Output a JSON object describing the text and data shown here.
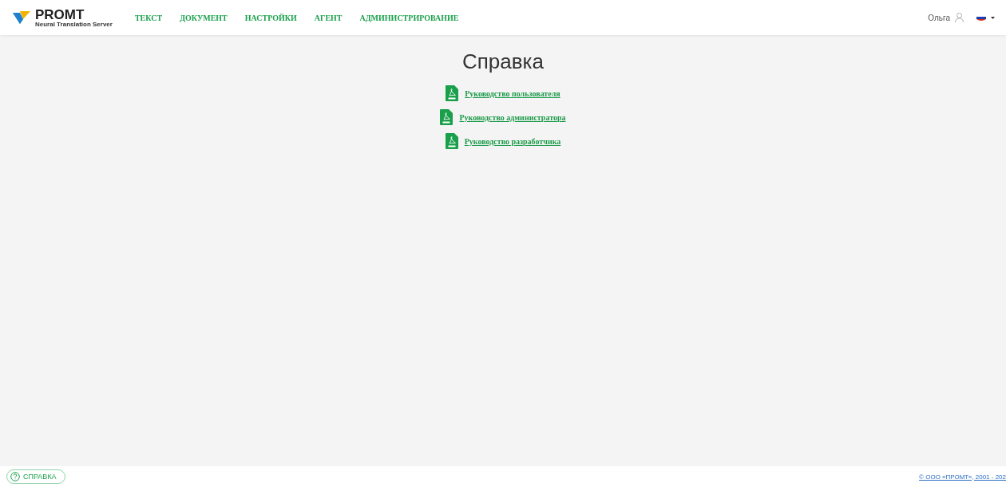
{
  "logo": {
    "name": "PROMT",
    "subtitle": "Neural Translation Server"
  },
  "nav": [
    "ТЕКСТ",
    "ДОКУМЕНТ",
    "НАСТРОЙКИ",
    "АГЕНТ",
    "АДМИНИСТРИРОВАНИЕ"
  ],
  "user": {
    "name": "Ольга"
  },
  "page": {
    "title": "Справка",
    "documents": [
      "Руководство пользователя",
      "Руководство администратора",
      "Руководство разработчика"
    ]
  },
  "footer": {
    "help_button": "СПРАВКА",
    "copyright": "© ООО «ПРОМТ», 2001 - 202"
  }
}
